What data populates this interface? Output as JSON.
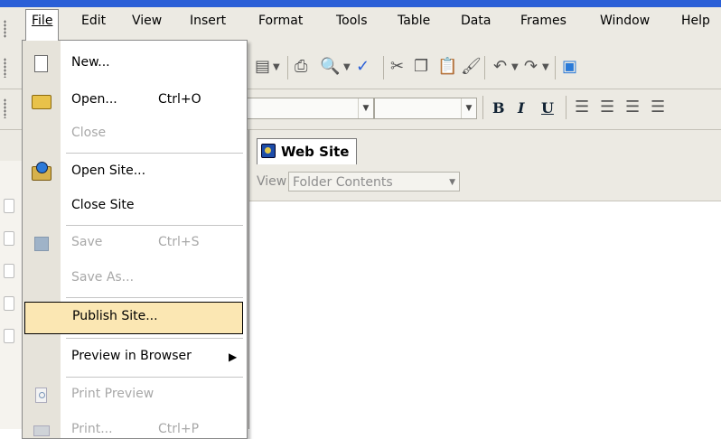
{
  "menubar": {
    "items": [
      "File",
      "Edit",
      "View",
      "Insert",
      "Format",
      "Tools",
      "Table",
      "Data",
      "Frames",
      "Window",
      "Help"
    ]
  },
  "file_menu": {
    "items": [
      {
        "label": "New...",
        "shortcut": "",
        "enabled": true,
        "icon": "new-page-icon"
      },
      {
        "label": "Open...",
        "shortcut": "Ctrl+O",
        "enabled": true,
        "icon": "open-folder-icon"
      },
      {
        "label": "Close",
        "shortcut": "",
        "enabled": false,
        "icon": ""
      },
      {
        "label": "Open Site...",
        "shortcut": "",
        "enabled": true,
        "icon": "open-site-icon"
      },
      {
        "label": "Close Site",
        "shortcut": "",
        "enabled": true,
        "icon": ""
      },
      {
        "label": "Save",
        "shortcut": "Ctrl+S",
        "enabled": false,
        "icon": "save-disk-icon"
      },
      {
        "label": "Save As...",
        "shortcut": "",
        "enabled": false,
        "icon": ""
      },
      {
        "label": "Publish Site...",
        "shortcut": "",
        "enabled": true,
        "icon": "",
        "highlighted": true
      },
      {
        "label": "Preview in Browser",
        "shortcut": "",
        "enabled": true,
        "icon": "",
        "submenu": true
      },
      {
        "label": "Print Preview",
        "shortcut": "",
        "enabled": false,
        "icon": "print-preview-icon"
      },
      {
        "label": "Print...",
        "shortcut": "Ctrl+P",
        "enabled": false,
        "icon": "printer-icon"
      }
    ]
  },
  "formatting": {
    "bold": "B",
    "italic": "I",
    "underline": "U"
  },
  "document": {
    "tab_label": "Web Site",
    "view_label": "View",
    "view_value": "Folder Contents"
  },
  "colors": {
    "highlight": "#fbe7b3",
    "menubar": "#eceae3",
    "titlebar": "#2a5fd7"
  }
}
